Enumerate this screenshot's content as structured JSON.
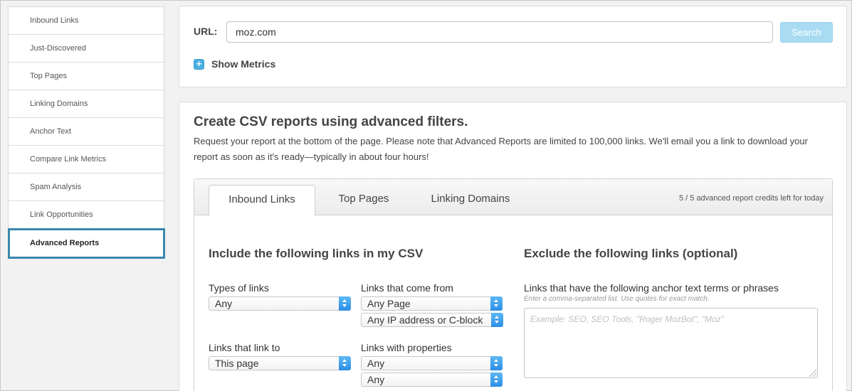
{
  "sidebar": {
    "items": [
      {
        "label": "Inbound Links"
      },
      {
        "label": "Just-Discovered"
      },
      {
        "label": "Top Pages"
      },
      {
        "label": "Linking Domains"
      },
      {
        "label": "Anchor Text"
      },
      {
        "label": "Compare Link Metrics"
      },
      {
        "label": "Spam Analysis"
      },
      {
        "label": "Link Opportunities"
      },
      {
        "label": "Advanced Reports",
        "active": true
      }
    ]
  },
  "url_bar": {
    "label": "URL:",
    "value": "moz.com",
    "search_label": "Search",
    "show_metrics_label": "Show Metrics"
  },
  "main": {
    "title": "Create CSV reports using advanced filters.",
    "description": "Request your report at the bottom of the page. Please note that Advanced Reports are limited to 100,000 links. We'll email you a link to download your report as soon as it's ready—typically in about four hours!",
    "tabs": [
      {
        "label": "Inbound Links",
        "active": true
      },
      {
        "label": "Top Pages"
      },
      {
        "label": "Linking Domains"
      }
    ],
    "credits": "5 / 5 advanced report credits left for today",
    "include": {
      "title": "Include the following links in my CSV",
      "types_label": "Types of links",
      "types_value": "Any",
      "come_from_label": "Links that come from",
      "come_from_value": "Any Page",
      "ip_value": "Any IP address or C-block",
      "link_to_label": "Links that link to",
      "link_to_value": "This page",
      "properties_label": "Links with properties",
      "properties_value_1": "Any",
      "properties_value_2": "Any"
    },
    "exclude": {
      "title": "Exclude the following links (optional)",
      "anchor_label": "Links that have the following anchor text terms or phrases",
      "hint": "Enter a comma-separated list. Use quotes for exact match.",
      "placeholder": "Example: SEO, SEO Tools, \"Roger MozBot\", \"Moz\""
    }
  },
  "colors": {
    "accent": "#3a87ad",
    "search_button": "#a9dcf3",
    "select_arrow": "#2b8ee6"
  }
}
